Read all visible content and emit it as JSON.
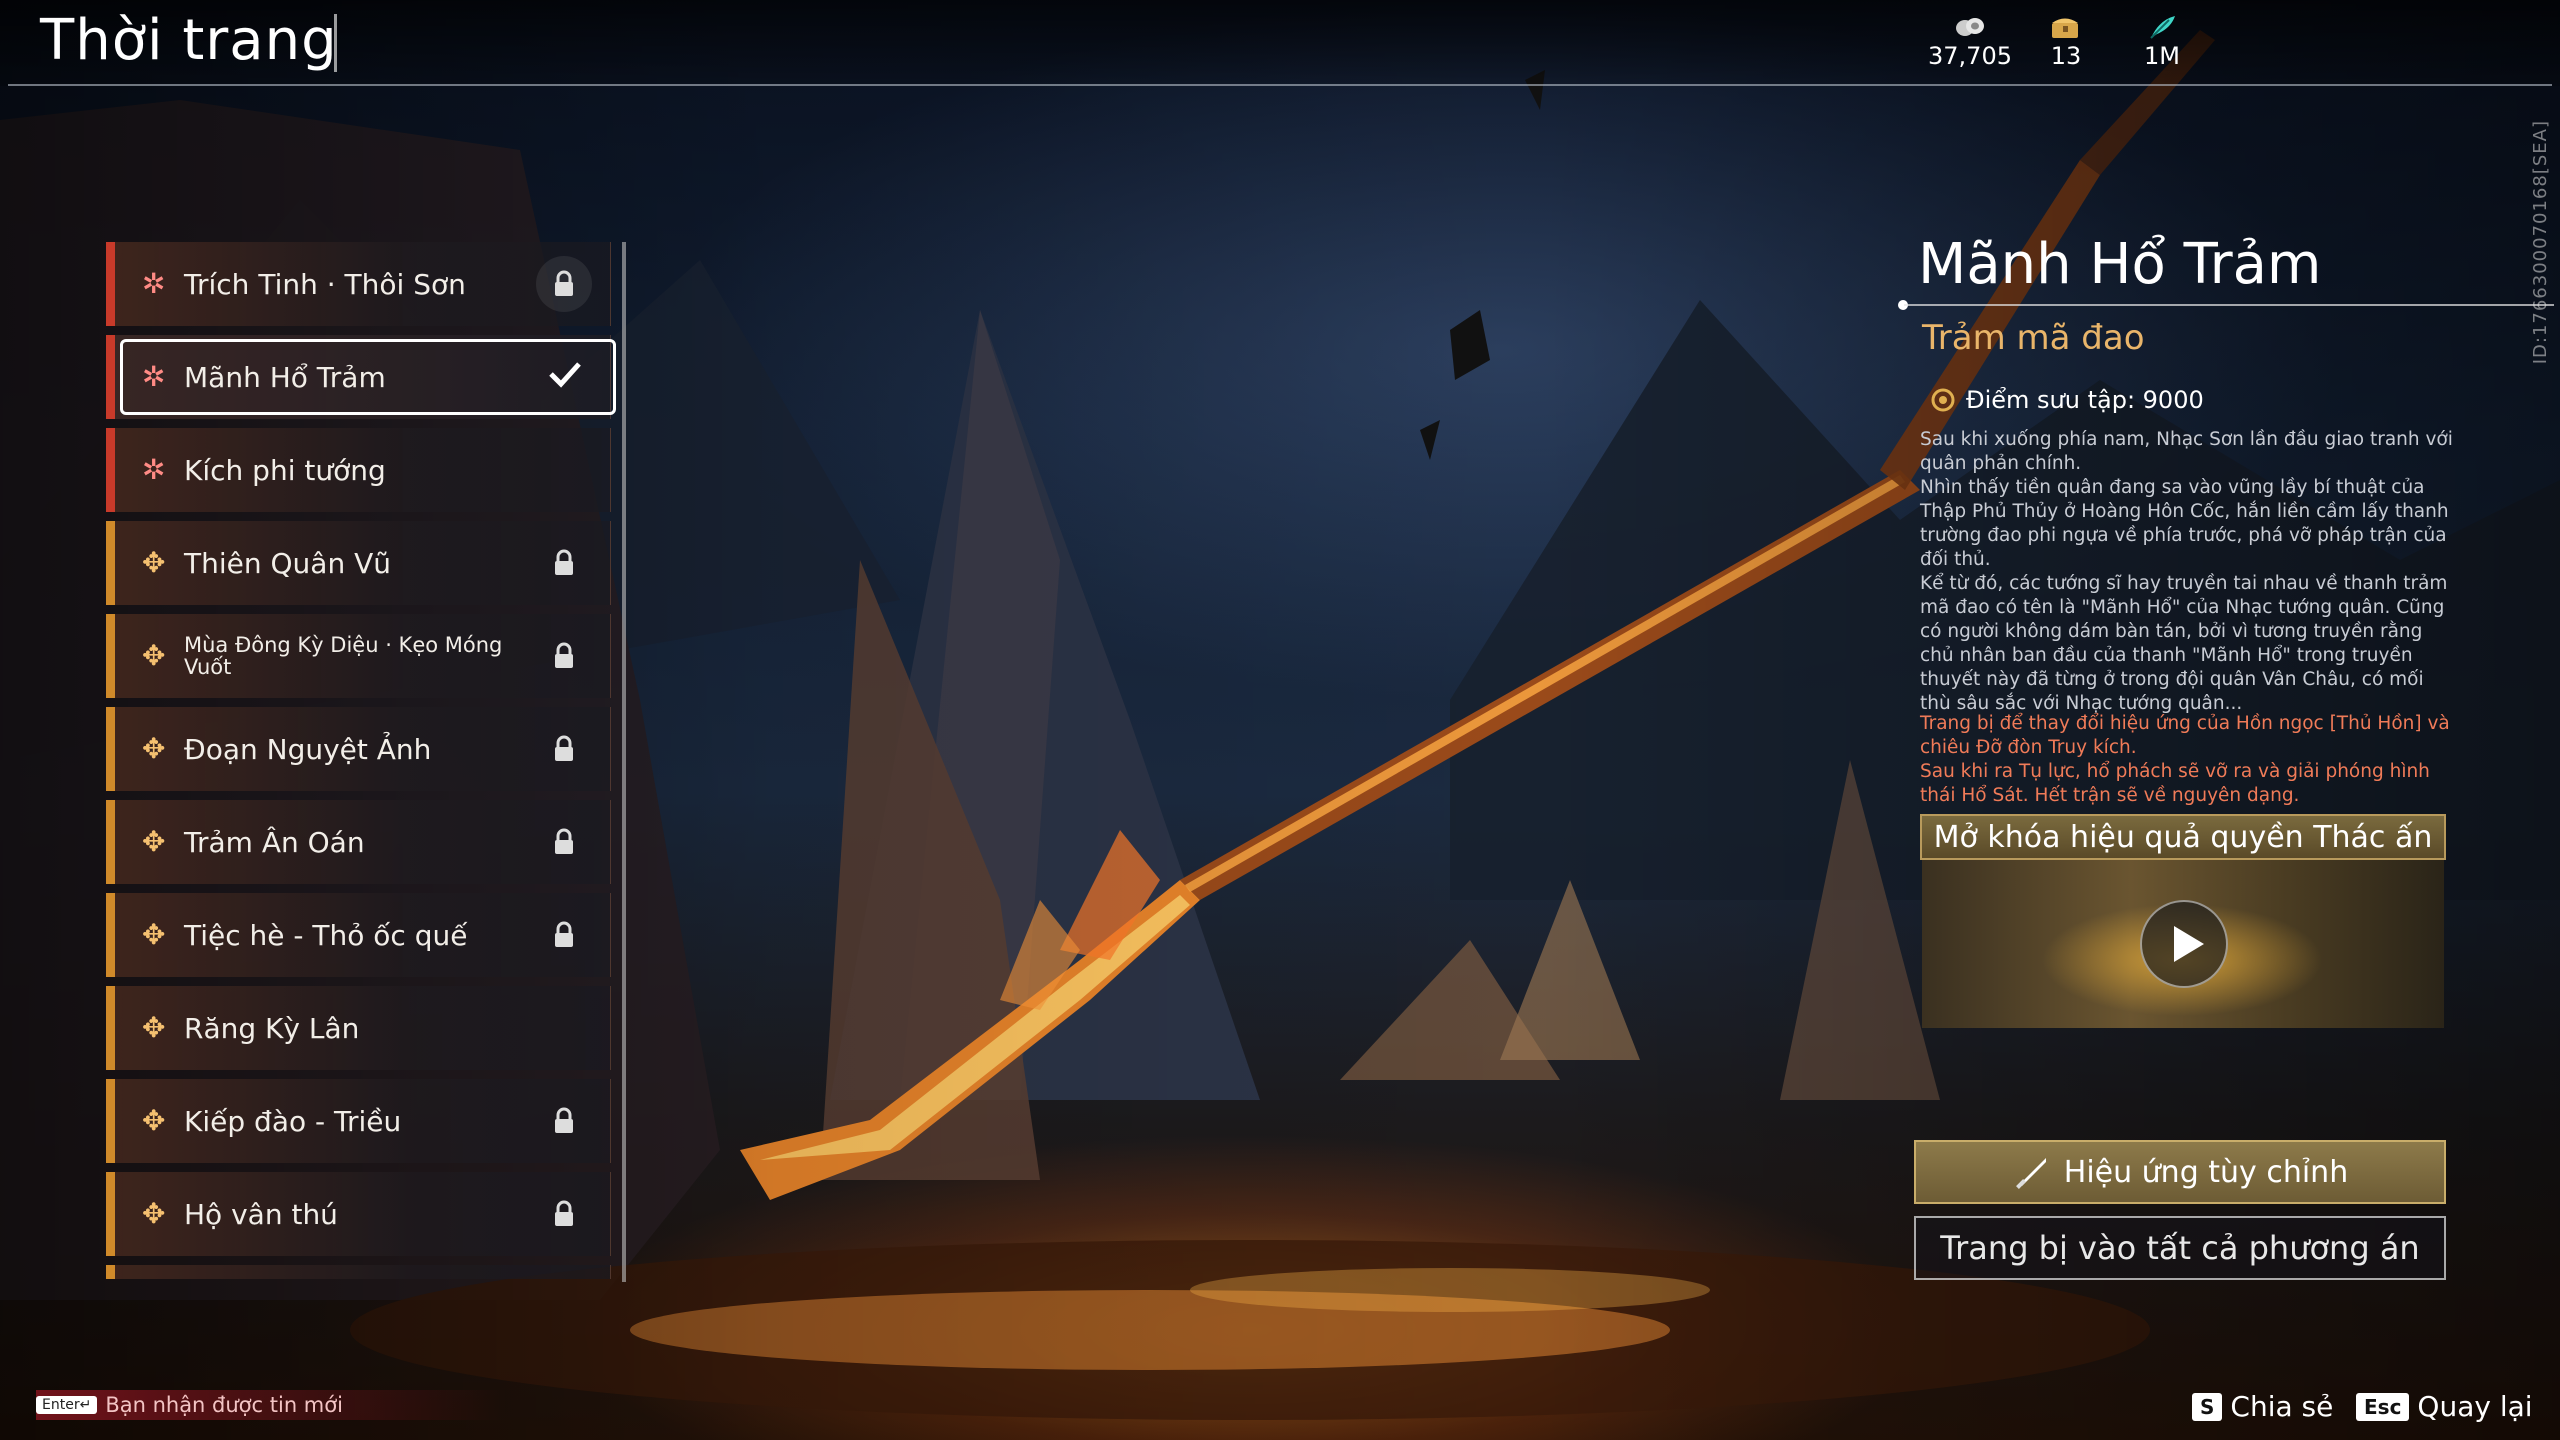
{
  "header": {
    "title": "Thời trang",
    "currencies": [
      {
        "icon": "coin-pile-icon",
        "value": "37,705"
      },
      {
        "icon": "treasure-chest-icon",
        "value": "13"
      },
      {
        "icon": "feather-icon",
        "value": "1M"
      }
    ]
  },
  "list": {
    "items": [
      {
        "label": "Trích Tinh · Thôi Sơn",
        "rarity": "red",
        "icon": "star-icon",
        "locked": true
      },
      {
        "label": "Mãnh Hổ Trảm",
        "rarity": "red",
        "icon": "star-icon",
        "selected": true
      },
      {
        "label": "Kích phi tướng",
        "rarity": "red",
        "icon": "star-icon",
        "locked": false
      },
      {
        "label": "Thiên Quân Vũ",
        "rarity": "orange",
        "icon": "cross-icon",
        "locked": true
      },
      {
        "label": "Mùa Đông Kỳ Diệu · Kẹo Móng Vuốt",
        "rarity": "orange",
        "icon": "cross-icon",
        "locked": true
      },
      {
        "label": "Đoạn Nguyệt Ảnh",
        "rarity": "orange",
        "icon": "cross-icon",
        "locked": true
      },
      {
        "label": "Trảm Ân Oán",
        "rarity": "orange",
        "icon": "cross-icon",
        "locked": true
      },
      {
        "label": "Tiệc hè - Thỏ ốc quế",
        "rarity": "orange",
        "icon": "cross-icon",
        "locked": true
      },
      {
        "label": "Răng Kỳ Lân",
        "rarity": "orange",
        "icon": "cross-icon",
        "locked": false
      },
      {
        "label": "Kiếp đào - Triều",
        "rarity": "orange",
        "icon": "cross-icon",
        "locked": true
      },
      {
        "label": "Hộ vân thú",
        "rarity": "orange",
        "icon": "cross-icon",
        "locked": true
      }
    ]
  },
  "detail": {
    "name": "Mãnh Hổ Trảm",
    "type": "Trảm mã đao",
    "points": "Điểm sưu tập: 9000",
    "description": "Sau khi xuống phía nam, Nhạc Sơn lần đầu giao tranh với quân phản chính.\nNhìn thấy tiền quân đang sa vào vũng lầy bí thuật của Thập Phủ Thủy ở Hoàng Hôn Cốc, hắn liền cầm lấy thanh trường đao phi ngựa về phía trước, phá vỡ pháp trận của đối thủ.\nKể từ đó, các tướng sĩ hay truyền tai nhau về thanh trảm mã đao có tên là \"Mãnh Hổ\" của Nhạc tướng quân. Cũng có người không dám bàn tán, bởi vì tương truyền rằng chủ nhân ban đầu của thanh \"Mãnh Hổ\" trong truyền thuyết này đã từng ở trong đội quân Vân Châu, có mối thù sâu sắc với Nhạc tướng quân...",
    "effect": "Trang bị để thay đổi hiệu ứng của Hồn ngọc [Thủ Hồn] và chiêu Đỡ đòn Truy kích.\n Sau khi ra Tụ lực, hổ phách sẽ vỡ ra và giải phóng hình thái Hổ Sát. Hết trận sẽ về nguyên dạng.",
    "unlock_label": "Mở khóa hiệu quả quyền Thác ấn",
    "customize_label": "Hiệu ứng tùy chỉnh",
    "equip_all_label": "Trang bị vào tất cả phương án"
  },
  "server_id": "ID:1766300070168[SEA]",
  "footer": {
    "notify_key": "Enter↵",
    "notify_text": "Bạn nhận được tin mới",
    "share_key": "S",
    "share_label": "Chia sẻ",
    "back_key": "Esc",
    "back_label": "Quay lại"
  },
  "colors": {
    "red_rarity": "#c83a2a",
    "orange_rarity": "#d08a2a",
    "gold_text": "#e9b56a",
    "effect_text": "#f07b58"
  }
}
